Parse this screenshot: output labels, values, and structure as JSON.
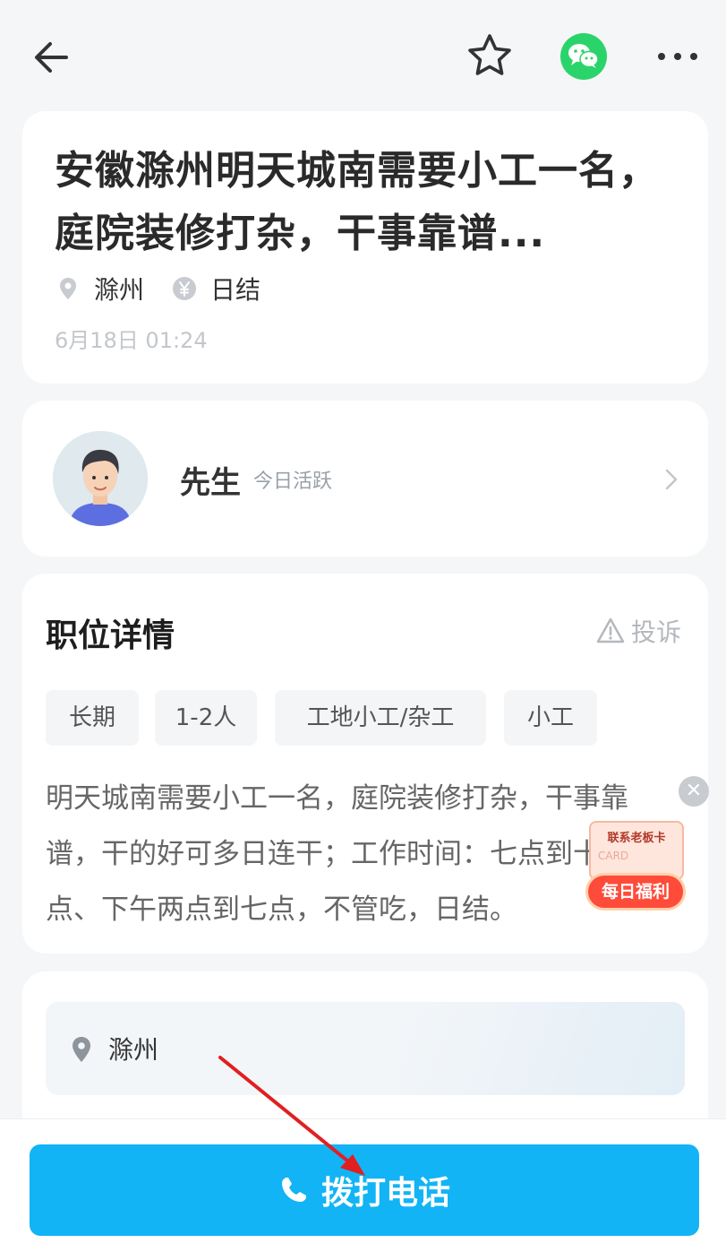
{
  "job": {
    "title": "安徽滁州明天城南需要小工一名，庭院装修打杂，干事靠谱...",
    "location": "滁州",
    "pay_type": "日结",
    "posted_time": "6月18日 01:24"
  },
  "employer": {
    "name": "先生",
    "status": "今日活跃"
  },
  "detail": {
    "section_title": "职位详情",
    "complain_label": "投诉",
    "tags": [
      "长期",
      "1-2人",
      "工地小工/杂工",
      "小工"
    ],
    "description": "明天城南需要小工一名，庭院装修打杂，干事靠谱，干的好可多日连干；工作时间：七点到十二点、下午两点到七点，不管吃，日结。"
  },
  "promo": {
    "card_label": "联系老板卡",
    "card_sub": "CARD",
    "banner_label": "每日福利"
  },
  "address": {
    "text": "滁州"
  },
  "actions": {
    "call_label": "拨打电话"
  },
  "icons": {
    "back": "back-arrow-icon",
    "favorite": "star-icon",
    "share": "wechat-icon",
    "more": "more-dots-icon",
    "phone": "phone-icon"
  },
  "colors": {
    "accent": "#12b4f5",
    "wechat_green": "#2bd46a",
    "annotation_red": "#e02020"
  }
}
